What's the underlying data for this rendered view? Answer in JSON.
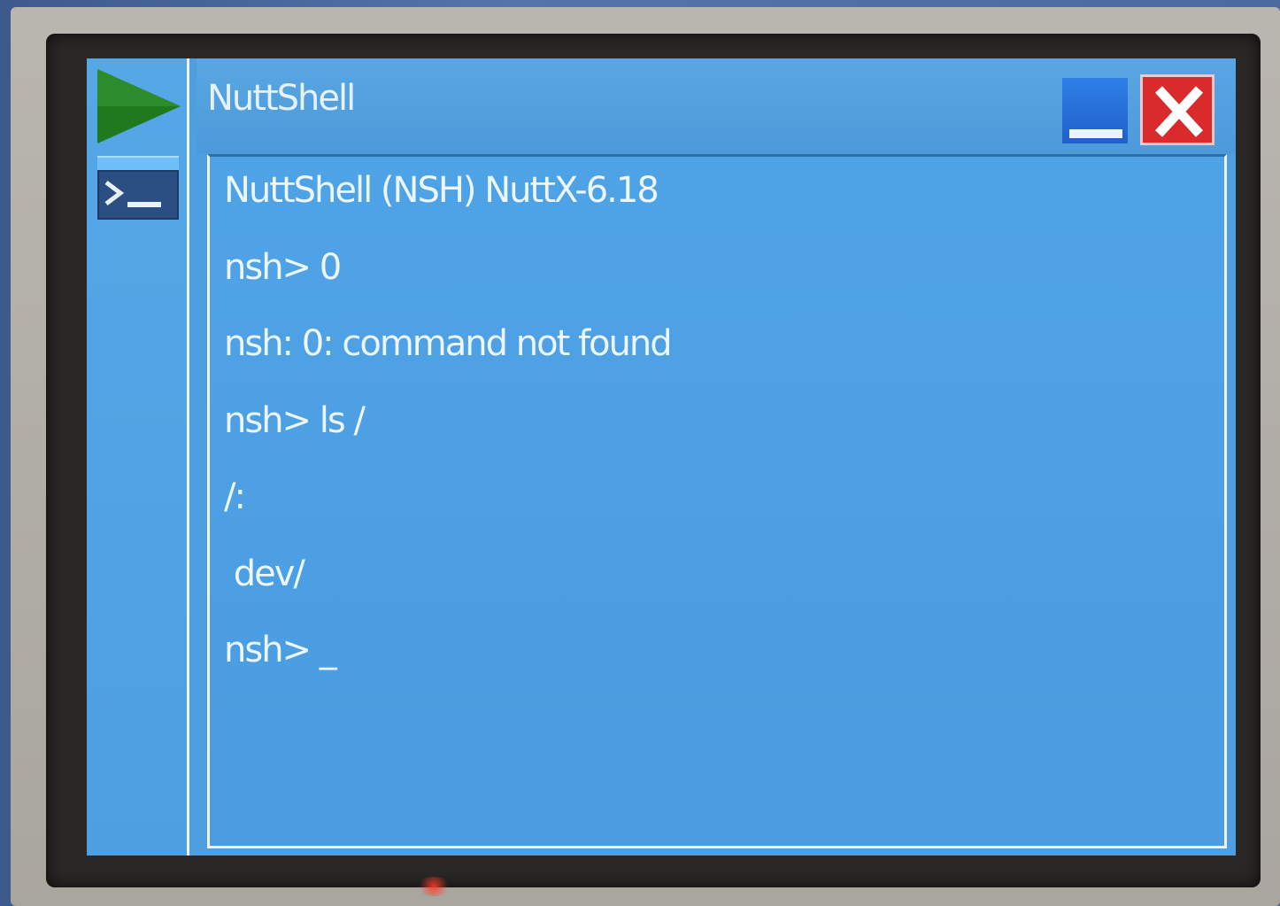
{
  "window": {
    "title": "NuttShell"
  },
  "taskbar": {
    "start_icon": "play-triangle-icon",
    "items": [
      {
        "icon": "terminal-prompt-icon",
        "app": "NuttShell"
      }
    ]
  },
  "titlebar_buttons": {
    "minimize_icon": "minimize-icon",
    "close_icon": "close-x-icon"
  },
  "console": {
    "lines": [
      "NuttShell (NSH) NuttX-6.18",
      "nsh> 0",
      "nsh: 0: command not found",
      "nsh> ls /",
      "/:",
      " dev/",
      "nsh> _"
    ]
  },
  "colors": {
    "desktop_blue": "#4f9fe0",
    "start_green": "#1f7a1f",
    "close_red": "#d92b2b",
    "minimize_blue": "#2f7fe8",
    "text": "#eef6fd"
  }
}
